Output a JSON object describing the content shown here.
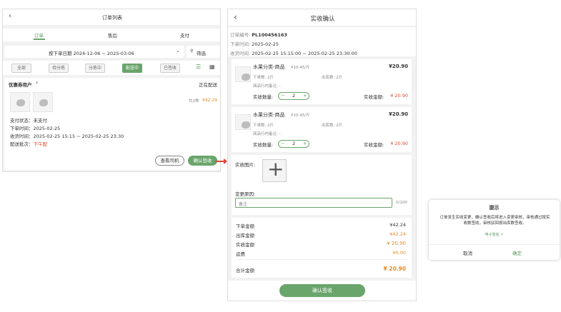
{
  "left": {
    "title": "订单列表",
    "tabs": [
      "订单",
      "售后",
      "支付"
    ],
    "date_range": "按下单日期 2024-12-06 ~ 2025-03-06",
    "filter": "筛选",
    "chips": [
      "全部",
      "待分拣",
      "分拣中",
      "配送中",
      "已签收"
    ],
    "order": {
      "customer": "优惠券用户",
      "status": "正在配送",
      "total_label": "共2种",
      "total": "¥42.24",
      "pay_status_label": "支付状态：",
      "pay_status": "未支付",
      "order_time_label": "下单时间：",
      "order_time": "2025-02-25",
      "receive_time_label": "收货时间：",
      "receive_time": "2025-02-25 15:15 ~ 2025-02-25 23:30",
      "batch_label": "配送批次：",
      "batch": "下午配",
      "view_driver": "查看司机",
      "confirm": "确认签收"
    }
  },
  "middle": {
    "title": "实收确认",
    "order_no_label": "订单编号:",
    "order_no": "PL100456163",
    "order_time_label": "下单时间:",
    "order_time": "2025-02-25",
    "receive_time_label": "收货时间:",
    "receive_time": "2025-02-25 15:15:00 ~ 2025-02-25 23:30:00",
    "items": [
      {
        "name": "水果分类-商品",
        "unit_price": "¥10.45/斤",
        "price": "¥20.90",
        "order_qty": "下单数: 2斤",
        "out_qty": "出库数: 2斤",
        "remark": "商品行内备注: -",
        "actual_qty_label": "实收数量:",
        "qty": "2",
        "actual_amount_label": "实收金额:",
        "actual_amount": "¥ 20.90"
      },
      {
        "name": "水果分类-商品",
        "unit_price": "¥10.45/斤",
        "price": "¥20.90",
        "order_qty": "下单数: 2斤",
        "out_qty": "出库数: 2斤",
        "remark": "商品行内备注: -",
        "actual_qty_label": "实收数量:",
        "qty": "2",
        "actual_amount_label": "实收金额:",
        "actual_amount": "¥ 20.90"
      }
    ],
    "photo_label": "实收图片:",
    "reason_label": "变更原因:",
    "reason_placeholder": "备注",
    "reason_count": "0/100",
    "summary": [
      {
        "label": "下单金额",
        "value": "¥42.24"
      },
      {
        "label": "出库金额",
        "value": "¥42.24"
      },
      {
        "label": "实收金额",
        "value": "¥ 20.90"
      },
      {
        "label": "运费",
        "value": "¥0.00"
      }
    ],
    "total_label": "合计金额",
    "total": "¥ 20.90",
    "submit": "确认签收"
  },
  "dialog": {
    "title": "提示",
    "message": "订单发生实收变更，确认签收后将进入变更审核，审核通过按实收数签收，审核驳回按出库数签收。",
    "link": "电子签名 >",
    "cancel": "取消",
    "ok": "确定"
  },
  "colors": {
    "accent": "#6aa56b",
    "red": "#e24a2c",
    "orange": "#e58a2a"
  }
}
